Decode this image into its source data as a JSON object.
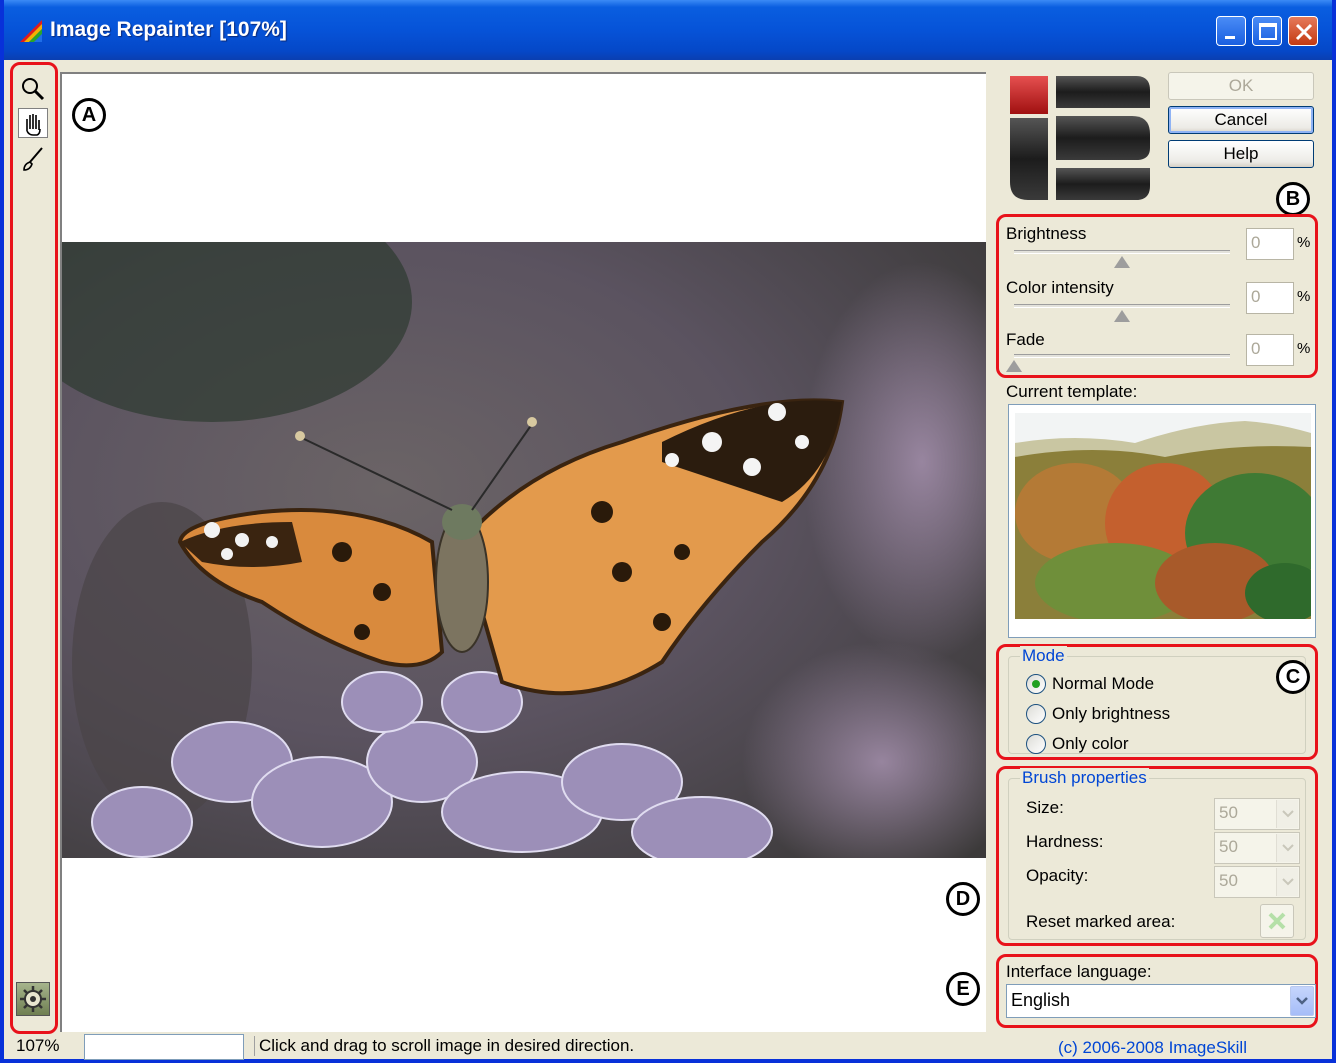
{
  "window": {
    "title": "Image Repainter [107%]"
  },
  "toolbar": {
    "tools": [
      "zoom-icon",
      "hand-icon",
      "brush-icon"
    ],
    "settings_icon": "gear-icon"
  },
  "markers": {
    "a": "A",
    "b": "B",
    "c": "C",
    "d": "D",
    "e": "E"
  },
  "buttons": {
    "ok": "OK",
    "cancel": "Cancel",
    "help": "Help"
  },
  "adjustments": {
    "brightness": {
      "label": "Brightness",
      "value": "0",
      "unit": "%",
      "slider_fraction": 0.5
    },
    "color_intensity": {
      "label": "Color intensity",
      "value": "0",
      "unit": "%",
      "slider_fraction": 0.5
    },
    "fade": {
      "label": "Fade",
      "value": "0",
      "unit": "%",
      "slider_fraction": 0.0
    }
  },
  "template": {
    "label": "Current template:"
  },
  "mode": {
    "title": "Mode",
    "options": [
      "Normal Mode",
      "Only brightness",
      "Only color"
    ],
    "selected": "Normal Mode"
  },
  "brush": {
    "title": "Brush properties",
    "size_label": "Size:",
    "size_value": "50",
    "hardness_label": "Hardness:",
    "hardness_value": "50",
    "opacity_label": "Opacity:",
    "opacity_value": "50",
    "reset_label": "Reset marked area:"
  },
  "language": {
    "label": "Interface language:",
    "value": "English"
  },
  "status": {
    "zoom": "107%",
    "message": "Click and drag to scroll image in desired direction.",
    "copyright": "(c) 2006-2008 ImageSkill"
  },
  "colors": {
    "title_bar": "#0653d8",
    "annotation": "#e8121b",
    "group_title": "#0046d5"
  }
}
